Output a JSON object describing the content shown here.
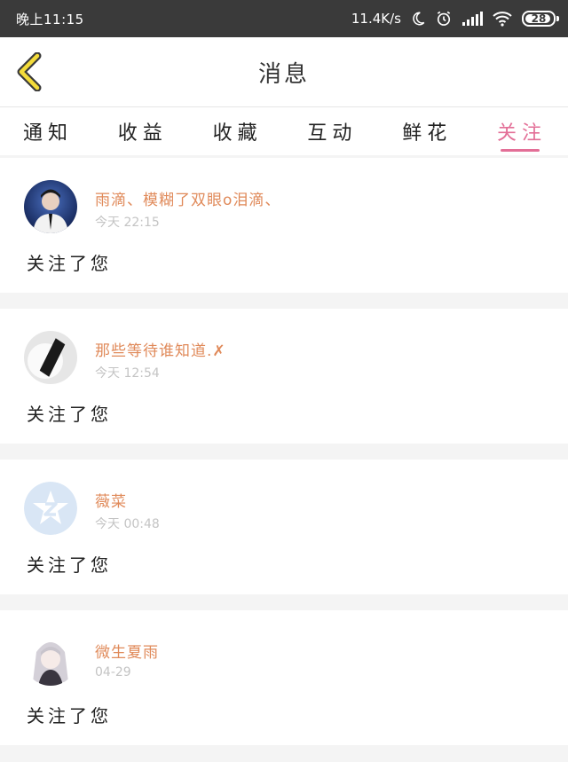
{
  "status_bar": {
    "time": "晚上11:15",
    "net_speed": "11.4K/s",
    "battery": "28"
  },
  "header": {
    "title": "消息"
  },
  "tabs": [
    {
      "label": "通知"
    },
    {
      "label": "收益"
    },
    {
      "label": "收藏"
    },
    {
      "label": "互动"
    },
    {
      "label": "鲜花"
    },
    {
      "label": "关注"
    }
  ],
  "active_tab": "关注",
  "messages": [
    {
      "user": "雨滴、模糊了双眼o泪滴、",
      "time": "今天 22:15",
      "text": "关注了您"
    },
    {
      "user": "那些等待谁知道.✗",
      "time": "今天 12:54",
      "text": "关注了您"
    },
    {
      "user": "薇菜",
      "time": "今天 00:48",
      "text": "关注了您"
    },
    {
      "user": "微生夏雨",
      "time": "04-29",
      "text": "关注了您"
    }
  ]
}
